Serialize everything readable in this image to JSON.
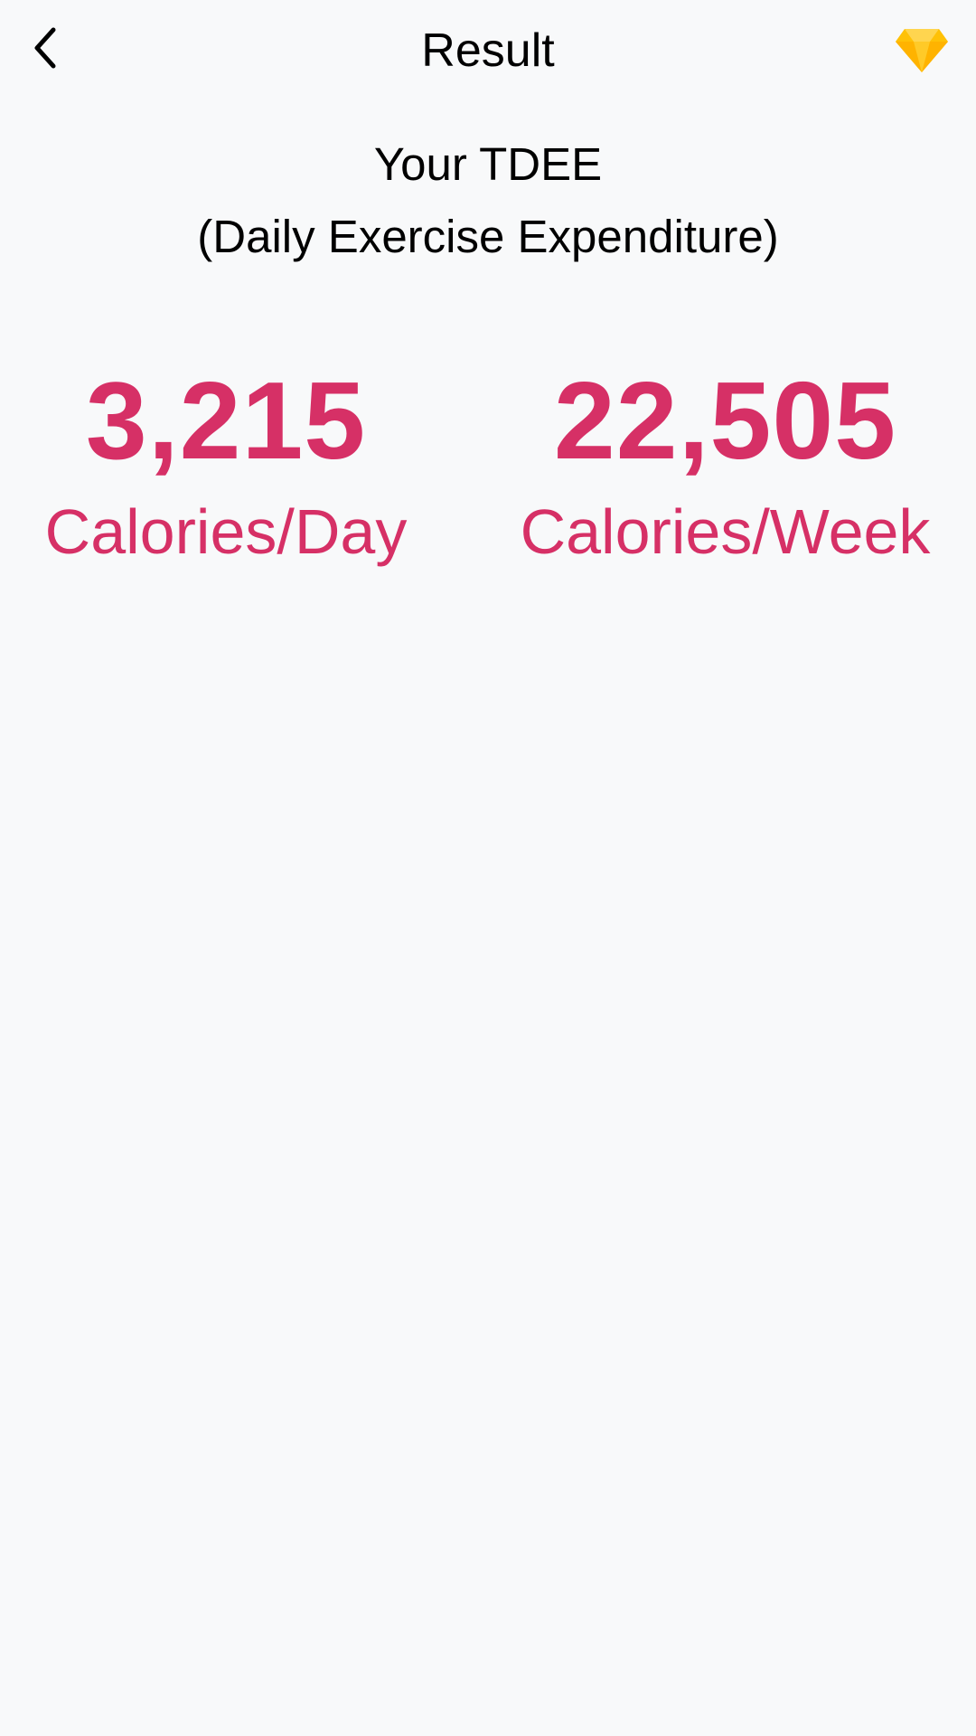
{
  "app_bar": {
    "title": "Result",
    "back_icon": "chevron-left-icon",
    "premium_icon": "diamond-icon"
  },
  "heading": {
    "line1": "Your TDEE",
    "line2": "(Daily Exercise Expenditure)"
  },
  "stats": {
    "daily": {
      "value": "3,215",
      "unit": "Calories/Day"
    },
    "weekly": {
      "value": "22,505",
      "unit": "Calories/Week"
    }
  },
  "colors": {
    "background": "#f8f9fa",
    "accent": "#d63066",
    "diamond": "#ffc107"
  }
}
